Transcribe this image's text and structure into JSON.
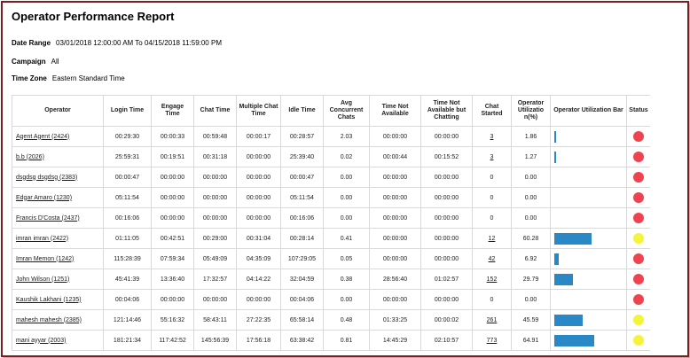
{
  "title": "Operator Performance Report",
  "filters": {
    "date_range_label": "Date Range",
    "date_range_value": "03/01/2018 12:00:00 AM  To 04/15/2018 11:59:00 PM",
    "campaign_label": "Campaign",
    "campaign_value": "All",
    "timezone_label": "Time Zone",
    "timezone_value": "Eastern Standard Time"
  },
  "columns": [
    "Operator",
    "Login Time",
    "Engage Time",
    "Chat Time",
    "Multiple Chat Time",
    "Idle Time",
    "Avg Concurrent Chats",
    "Time Not Available",
    "Time Not Available but Chatting",
    "Chat Started",
    "Operator Utilizatio n(%)",
    "Operator Utilization Bar",
    "Status"
  ],
  "colors": {
    "bar": "#2a88c6",
    "status_red": "#f0424f",
    "status_yellow": "#f4f43a"
  },
  "rows": [
    {
      "operator": "Agent Agent (2424)",
      "login": "00:29:30",
      "engage": "00:00:33",
      "chat": "00:59:48",
      "multi": "00:00:17",
      "idle": "00:28:57",
      "avg": "2.03",
      "tna": "00:00:00",
      "tnac": "00:00:00",
      "started": "3",
      "started_link": true,
      "util": "1.86",
      "util_pct": 1.86,
      "status": "red"
    },
    {
      "operator": "b.b (2026)",
      "login": "25:59:31",
      "engage": "00:19:51",
      "chat": "00:31:18",
      "multi": "00:00:00",
      "idle": "25:39:40",
      "avg": "0.02",
      "tna": "00:00:44",
      "tnac": "00:15:52",
      "started": "3",
      "started_link": true,
      "util": "1.27",
      "util_pct": 1.27,
      "status": "red"
    },
    {
      "operator": "dsgdsg dsgdsg (2383)",
      "login": "00:00:47",
      "engage": "00:00:00",
      "chat": "00:00:00",
      "multi": "00:00:00",
      "idle": "00:00:47",
      "avg": "0.00",
      "tna": "00:00:00",
      "tnac": "00:00:00",
      "started": "0",
      "started_link": false,
      "util": "0.00",
      "util_pct": 0,
      "status": "red"
    },
    {
      "operator": "Edgar Amaro (1230)",
      "login": "05:11:54",
      "engage": "00:00:00",
      "chat": "00:00:00",
      "multi": "00:00:00",
      "idle": "05:11:54",
      "avg": "0.00",
      "tna": "00:00:00",
      "tnac": "00:00:00",
      "started": "0",
      "started_link": false,
      "util": "0.00",
      "util_pct": 0,
      "status": "red"
    },
    {
      "operator": "Francis D'Costa (2437)",
      "login": "00:16:06",
      "engage": "00:00:00",
      "chat": "00:00:00",
      "multi": "00:00:00",
      "idle": "00:16:06",
      "avg": "0.00",
      "tna": "00:00:00",
      "tnac": "00:00:00",
      "started": "0",
      "started_link": false,
      "util": "0.00",
      "util_pct": 0,
      "status": "red"
    },
    {
      "operator": "imran imran (2422)",
      "login": "01:11:05",
      "engage": "00:42:51",
      "chat": "00:29:00",
      "multi": "00:31:04",
      "idle": "00:28:14",
      "avg": "0.41",
      "tna": "00:00:00",
      "tnac": "00:00:00",
      "started": "12",
      "started_link": true,
      "util": "60.28",
      "util_pct": 60.28,
      "status": "yellow"
    },
    {
      "operator": "Imran Memon (1242)",
      "login": "115:28:39",
      "engage": "07:59:34",
      "chat": "05:49:09",
      "multi": "04:35:09",
      "idle": "107:29:05",
      "avg": "0.05",
      "tna": "00:00:00",
      "tnac": "00:00:00",
      "started": "42",
      "started_link": true,
      "util": "6.92",
      "util_pct": 6.92,
      "status": "red"
    },
    {
      "operator": "John Wilson (1251)",
      "login": "45:41:39",
      "engage": "13:36:40",
      "chat": "17:32:57",
      "multi": "04:14:22",
      "idle": "32:04:59",
      "avg": "0.38",
      "tna": "28:56:40",
      "tnac": "01:02:57",
      "started": "152",
      "started_link": true,
      "util": "29.79",
      "util_pct": 29.79,
      "status": "red"
    },
    {
      "operator": "Kaushik Lakhani (1235)",
      "login": "00:04:06",
      "engage": "00:00:00",
      "chat": "00:00:00",
      "multi": "00:00:00",
      "idle": "00:04:06",
      "avg": "0.00",
      "tna": "00:00:00",
      "tnac": "00:00:00",
      "started": "0",
      "started_link": false,
      "util": "0.00",
      "util_pct": 0,
      "status": "red"
    },
    {
      "operator": "mahesh mahesh (2385)",
      "login": "121:14:46",
      "engage": "55:16:32",
      "chat": "58:43:11",
      "multi": "27:22:35",
      "idle": "65:58:14",
      "avg": "0.48",
      "tna": "01:33:25",
      "tnac": "00:00:02",
      "started": "261",
      "started_link": true,
      "util": "45.59",
      "util_pct": 45.59,
      "status": "yellow"
    },
    {
      "operator": "mani ayyar (2003)",
      "login": "181:21:34",
      "engage": "117:42:52",
      "chat": "145:56:39",
      "multi": "17:56:18",
      "idle": "63:38:42",
      "avg": "0.81",
      "tna": "14:45:29",
      "tnac": "02:10:57",
      "started": "773",
      "started_link": true,
      "util": "64.91",
      "util_pct": 64.91,
      "status": "yellow"
    }
  ]
}
